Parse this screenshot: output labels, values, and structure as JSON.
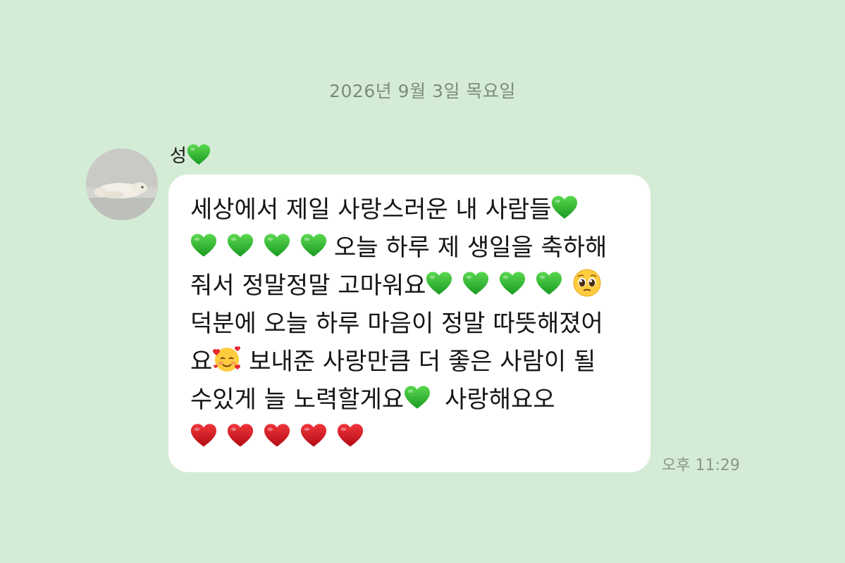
{
  "date_divider": "2026년 9월 3일 목요일",
  "sender": {
    "name": "성",
    "name_emoji": "green-heart"
  },
  "message": {
    "lines": [
      "세상에서 제일 사랑스러운 내 사람들",
      "오늘 하루 제 생일을 축하해",
      "줘서 정말정말 고마워요",
      "덕분에 오늘 하루 마음이 정말 따뜻해졌어",
      "요",
      "보내준 사랑만큼 더 좋은 사람이 될",
      "수있게 늘 노력할게요",
      "사랑해요오"
    ],
    "emojis": [
      "green-heart",
      "pleading-face",
      "smiling-face-with-hearts",
      "red-heart"
    ]
  },
  "timestamp": "오후 11:29",
  "colors": {
    "background": "#d4ecd5",
    "bubble": "#ffffff",
    "green_heart": "#2fbf2f",
    "red_heart": "#d8131c"
  }
}
